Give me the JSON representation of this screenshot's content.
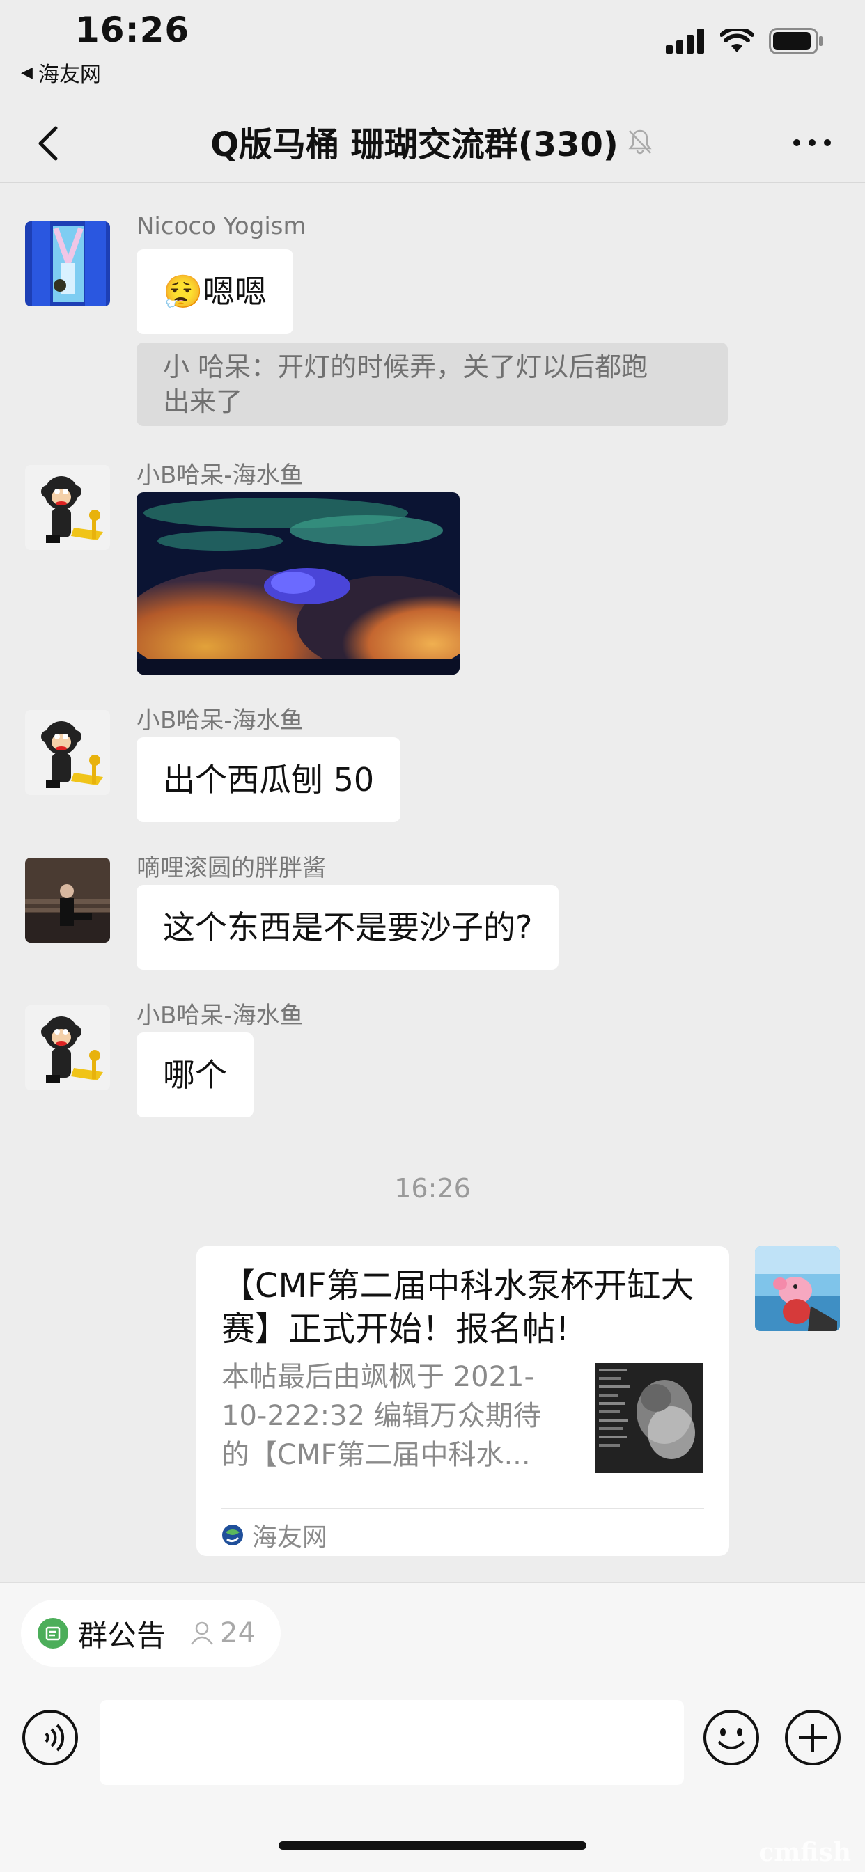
{
  "status_bar": {
    "time": "16:26",
    "back_app": "海友网"
  },
  "nav": {
    "title": "Q版马桶 珊瑚交流群(330)"
  },
  "messages": [
    {
      "sender": "Nicoco Yogism",
      "emoji": "😮‍💨",
      "text": "嗯嗯"
    },
    {
      "quote_line1": "小 哈呆：开灯的时候弄，关了灯以后都跑",
      "quote_line2": "出来了"
    },
    {
      "sender": "小B哈呆-海水鱼"
    },
    {
      "sender": "小B哈呆-海水鱼",
      "text": "出个西瓜刨 50"
    },
    {
      "sender": "嘀哩滚圆的胖胖酱",
      "text": "这个东西是不是要沙子的?"
    },
    {
      "sender": "小B哈呆-海水鱼",
      "text": "哪个"
    }
  ],
  "timestamp": "16:26",
  "link_card": {
    "title": "【CMF第二届中科水泵杯开缸大赛】正式开始！报名帖!",
    "desc_line1": "本帖最后由飒枫于 2021-",
    "desc_line2": "10-222:32 编辑万众期待",
    "desc_line3": "的【CMF第二届中科水...",
    "source": "海友网"
  },
  "bottom": {
    "notice_label": "群公告",
    "notice_count": "24"
  },
  "watermark": "cmfish"
}
